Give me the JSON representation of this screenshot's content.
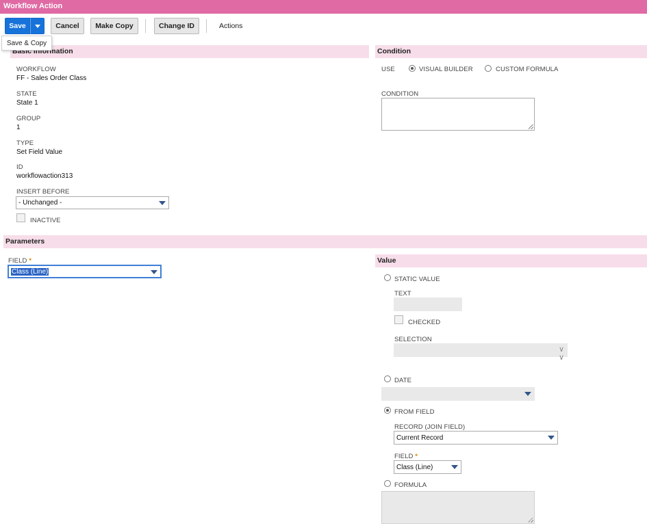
{
  "titlebar": {
    "title": "Workflow Action"
  },
  "toolbar": {
    "save_label": "Save",
    "cancel_label": "Cancel",
    "make_copy_label": "Make Copy",
    "change_id_label": "Change ID",
    "actions_label": "Actions",
    "save_menu_item": "Save & Copy"
  },
  "basic_info": {
    "header": "Basic Information",
    "workflow_label": "WORKFLOW",
    "workflow_value": "FF - Sales Order Class",
    "state_label": "STATE",
    "state_value": "State 1",
    "group_label": "GROUP",
    "group_value": "1",
    "type_label": "TYPE",
    "type_value": "Set Field Value",
    "id_label": "ID",
    "id_value": "workflowaction313",
    "insert_before_label": "INSERT BEFORE",
    "insert_before_value": "- Unchanged -",
    "inactive_label": "INACTIVE",
    "inactive_checked": false
  },
  "condition": {
    "header": "Condition",
    "use_label": "USE",
    "visual_builder_label": "VISUAL BUILDER",
    "custom_formula_label": "CUSTOM FORMULA",
    "selected": "visual_builder",
    "condition_label": "CONDITION",
    "condition_value": ""
  },
  "parameters": {
    "header": "Parameters",
    "field_label": "FIELD",
    "field_value": "Class (Line)",
    "required_marker": "*"
  },
  "value": {
    "header": "Value",
    "static_value_label": "STATIC VALUE",
    "text_label": "TEXT",
    "text_value": "",
    "checked_label": "CHECKED",
    "selection_label": "SELECTION",
    "selection_value": "",
    "date_label": "DATE",
    "date_value": "",
    "from_field_label": "FROM FIELD",
    "record_label": "RECORD (JOIN FIELD)",
    "record_value": "Current Record",
    "field_label": "FIELD",
    "field_value": "Class (Line)",
    "required_marker": "*",
    "formula_label": "FORMULA",
    "formula_value": "",
    "selected": "from_field"
  },
  "colors": {
    "titlebar": "#df6aa4",
    "section_header": "#f7dde9",
    "primary_button": "#1773da",
    "caret": "#33568a",
    "required_star": "#d18b00"
  }
}
